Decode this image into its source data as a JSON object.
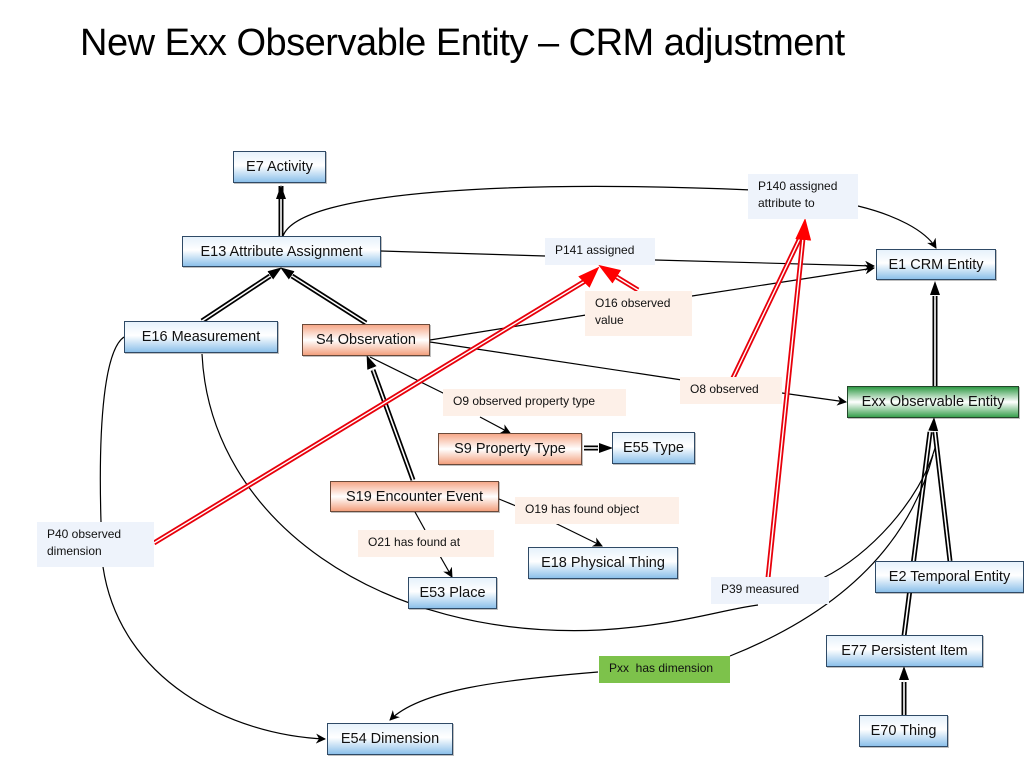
{
  "title": "New Exx Observable Entity – CRM adjustment",
  "colors": {
    "crm_class": "#8cc0ea",
    "sci_class": "#f3a07e",
    "new_class": "#37a04d",
    "crm_property_label": "#eef3fb",
    "sci_property_label": "#fdf0e8",
    "new_property_label": "#7dc24b",
    "removed_link": "#e8000b"
  },
  "nodes": {
    "e7": "E7 Activity",
    "e13": "E13 Attribute Assignment",
    "e1": "E1 CRM Entity",
    "e16": "E16 Measurement",
    "s4": "S4 Observation",
    "exx": "Exx Observable Entity",
    "s9": "S9 Property Type",
    "e55": "E55 Type",
    "s19": "S19 Encounter Event",
    "e18": "E18 Physical Thing",
    "e53": "E53 Place",
    "e2": "E2 Temporal Entity",
    "e77": "E77 Persistent Item",
    "e70": "E70 Thing",
    "e54": "E54 Dimension"
  },
  "properties": {
    "p140": "P140 assigned attribute to",
    "p141": "P141 assigned",
    "o16": "O16 observed value",
    "o8": "O8 observed",
    "o9": "O9 observed property type",
    "o19": "O19 has found object",
    "o21": "O21 has found at",
    "p40": "P40 observed dimension",
    "p39": "P39 measured",
    "pxx": "Pxx  has dimension"
  },
  "edges": [
    {
      "from": "E13 Attribute Assignment",
      "to": "E7 Activity",
      "kind": "subclass"
    },
    {
      "from": "E16 Measurement",
      "to": "E13 Attribute Assignment",
      "kind": "subclass"
    },
    {
      "from": "S4 Observation",
      "to": "E13 Attribute Assignment",
      "kind": "subclass"
    },
    {
      "from": "S19 Encounter Event",
      "to": "S4 Observation",
      "kind": "subclass"
    },
    {
      "from": "S9 Property Type",
      "to": "E55 Type",
      "kind": "subclass"
    },
    {
      "from": "Exx Observable Entity",
      "to": "E1 CRM Entity",
      "kind": "subclass"
    },
    {
      "from": "E2 Temporal Entity",
      "to": "Exx Observable Entity",
      "kind": "subclass"
    },
    {
      "from": "E77 Persistent Item",
      "to": "Exx Observable Entity",
      "kind": "subclass"
    },
    {
      "from": "E70 Thing",
      "to": "E77 Persistent Item",
      "kind": "subclass"
    },
    {
      "from": "E13 Attribute Assignment",
      "to": "E1 CRM Entity",
      "kind": "property",
      "label": "P140 assigned attribute to"
    },
    {
      "from": "E13 Attribute Assignment",
      "to": "E1 CRM Entity",
      "kind": "property",
      "label": "P141 assigned"
    },
    {
      "from": "S4 Observation",
      "to": "E1 CRM Entity",
      "kind": "property",
      "label": "O16 observed value"
    },
    {
      "from": "S4 Observation",
      "to": "Exx Observable Entity",
      "kind": "property",
      "label": "O8 observed"
    },
    {
      "from": "S4 Observation",
      "to": "S9 Property Type",
      "kind": "property",
      "label": "O9 observed property type"
    },
    {
      "from": "S19 Encounter Event",
      "to": "E18 Physical Thing",
      "kind": "property",
      "label": "O19 has found object"
    },
    {
      "from": "S19 Encounter Event",
      "to": "E53 Place",
      "kind": "property",
      "label": "O21 has found at"
    },
    {
      "from": "E16 Measurement",
      "to": "E54 Dimension",
      "kind": "property",
      "label": "P40 observed dimension"
    },
    {
      "from": "E16 Measurement",
      "to": "Exx Observable Entity",
      "kind": "property",
      "label": "P39 measured"
    },
    {
      "from": "Exx Observable Entity",
      "to": "E54 Dimension",
      "kind": "property",
      "label": "Pxx  has dimension"
    },
    {
      "from": "P40 observed dimension",
      "to": "P141 assigned",
      "kind": "subproperty"
    },
    {
      "from": "O16 observed value",
      "to": "P141 assigned",
      "kind": "subproperty"
    },
    {
      "from": "O8 observed",
      "to": "P140 assigned attribute to",
      "kind": "subproperty"
    },
    {
      "from": "P39 measured",
      "to": "P140 assigned attribute to",
      "kind": "subproperty"
    }
  ]
}
